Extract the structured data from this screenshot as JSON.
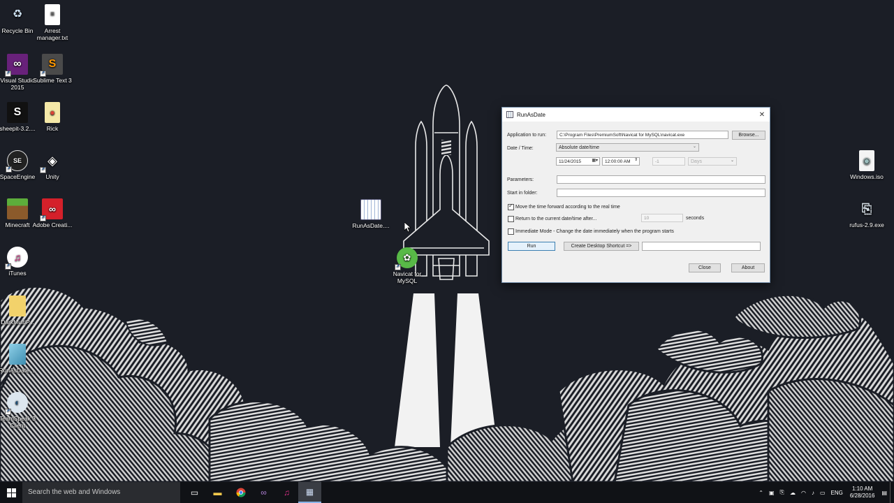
{
  "desktop": {
    "icons_left": [
      {
        "label": "Recycle Bin",
        "icon": "recycle-bin-icon"
      },
      {
        "label": "Arrest manager.txt",
        "icon": "text-file-icon"
      },
      {
        "label": "Visual Studio 2015",
        "icon": "visual-studio-icon"
      },
      {
        "label": "Sublime Text 3",
        "icon": "sublime-text-icon"
      },
      {
        "label": "sheepit-3.2....",
        "icon": "sheepit-icon"
      },
      {
        "label": "Rick",
        "icon": "chrome-file-icon"
      },
      {
        "label": "SpaceEngine",
        "icon": "spaceengine-icon"
      },
      {
        "label": "Unity",
        "icon": "unity-icon"
      },
      {
        "label": "Minecraft",
        "icon": "minecraft-icon"
      },
      {
        "label": "Adobe Creati...",
        "icon": "adobe-cc-icon"
      },
      {
        "label": "iTunes",
        "icon": "itunes-icon"
      },
      {
        "label": "DarkMultiP...",
        "icon": "folder-zip-icon"
      },
      {
        "label": "RunAsDate....",
        "icon": "runasdate-archive-icon"
      },
      {
        "label": "TeamSpeak 3 Client",
        "icon": "teamspeak-icon"
      }
    ],
    "icons_middle": [
      {
        "label": "RunAsDate....",
        "icon": "calendar-icon"
      },
      {
        "label": "Navicat for MySQL",
        "icon": "navicat-icon"
      }
    ],
    "icons_right": [
      {
        "label": "Windows.iso",
        "icon": "iso-disc-icon"
      },
      {
        "label": "rufus-2.9.exe",
        "icon": "usb-drive-icon"
      }
    ]
  },
  "window": {
    "title": "RunAsDate",
    "app_label": "Application to run:",
    "app_value": "C:\\Program Files\\PremiumSoft\\Navicat for MySQL\\navicat.exe",
    "browse_label": "Browse...",
    "datetime_label": "Date / Time:",
    "datetime_mode": "Absolute date/time",
    "date_value": "11/24/2015",
    "time_value": "12:00:00 AM",
    "offset_value": "-1",
    "offset_unit": "Days",
    "params_label": "Parameters:",
    "params_value": "",
    "start_folder_label": "Start in folder:",
    "start_folder_value": "",
    "move_forward_label": "Move the time forward according to the real time",
    "move_forward_checked": true,
    "return_label": "Return to the current date/time after...",
    "return_checked": false,
    "return_value": "10",
    "return_unit": "seconds",
    "immediate_label": "Immediate Mode - Change the date immediately when the program starts",
    "immediate_checked": false,
    "run_label": "Run",
    "shortcut_label": "Create Desktop Shortcut =>",
    "shortcut_name_value": "",
    "close_label": "Close",
    "about_label": "About"
  },
  "taskbar": {
    "search_placeholder": "Search the web and Windows",
    "pinned": [
      "task-view-icon",
      "file-explorer-icon",
      "chrome-icon",
      "visual-studio-icon",
      "itunes-icon",
      "runasdate-icon"
    ],
    "language": "ENG",
    "time": "1:10 AM",
    "date": "6/28/2016"
  },
  "colors": {
    "wallpaper_bg": "#1b1e26",
    "taskbar_bg": "#101216",
    "window_bg": "#f0f0f0"
  }
}
